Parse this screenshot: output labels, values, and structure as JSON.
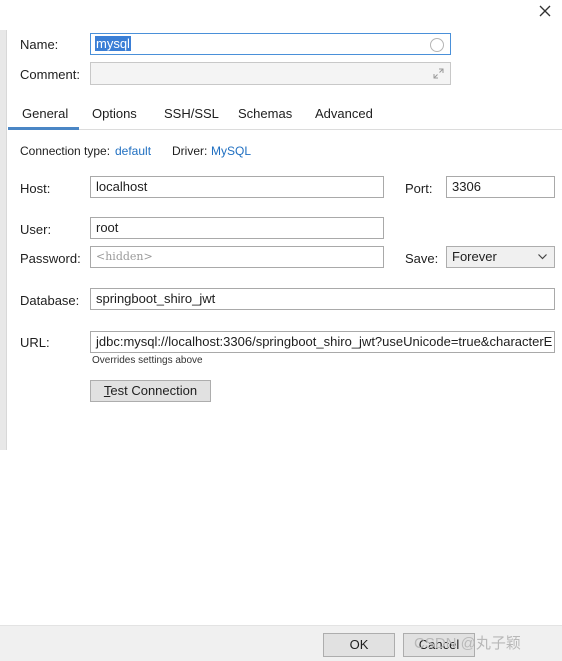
{
  "form": {
    "name_label": "Name:",
    "name_value": "mysql",
    "comment_label": "Comment:",
    "comment_value": ""
  },
  "tabs": [
    {
      "label": "General",
      "active": true
    },
    {
      "label": "Options",
      "active": false
    },
    {
      "label": "SSH/SSL",
      "active": false
    },
    {
      "label": "Schemas",
      "active": false
    },
    {
      "label": "Advanced",
      "active": false
    }
  ],
  "general": {
    "connection_type_label": "Connection type:",
    "connection_type_value": "default",
    "driver_label": "Driver:",
    "driver_value": "MySQL",
    "host_label": "Host:",
    "host_value": "localhost",
    "port_label": "Port:",
    "port_value": "3306",
    "user_label": "User:",
    "user_value": "root",
    "password_label": "Password:",
    "password_placeholder": "<hidden>",
    "save_label": "Save:",
    "save_value": "Forever",
    "database_label": "Database:",
    "database_value": "springboot_shiro_jwt",
    "url_label": "URL:",
    "url_value": "jdbc:mysql://localhost:3306/springboot_shiro_jwt?useUnicode=true&characterE",
    "url_hint": "Overrides settings above",
    "test_connection_button": "Test Connection"
  },
  "footer": {
    "ok_button": "OK",
    "cancel_button": "Cancel",
    "watermark": "CSDN @丸子颖"
  },
  "colors": {
    "accent": "#1f6fc1",
    "tab_underline": "#4a86c5",
    "selection": "#3b7fd6",
    "focus_border": "#4a90d9"
  },
  "icons": {
    "close": "close-icon",
    "name_status": "circle-status-icon",
    "expand": "expand-icon",
    "dropdown": "chevron-down-icon"
  }
}
